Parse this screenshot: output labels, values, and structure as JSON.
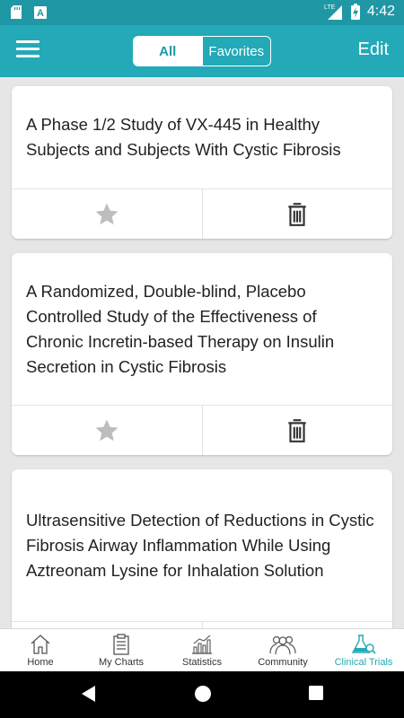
{
  "status_bar": {
    "time": "4:42",
    "network": "LTE",
    "icons": [
      "sd-card-icon",
      "font-a-icon",
      "signal-icon",
      "battery-charging-icon"
    ]
  },
  "header": {
    "segments": [
      {
        "label": "All",
        "active": true
      },
      {
        "label": "Favorites",
        "active": false
      }
    ],
    "edit_label": "Edit",
    "colors": {
      "accent": "#23a9b7",
      "status": "#1f97a5"
    }
  },
  "trials": [
    {
      "title": "A Phase 1/2 Study of VX-445 in Healthy Subjects and Subjects With Cystic Fibrosis",
      "favorited": false
    },
    {
      "title": "A Randomized, Double-blind, Placebo Controlled Study of the Effectiveness of Chronic Incretin-based Therapy on Insulin Secretion in Cystic Fibrosis",
      "favorited": false
    },
    {
      "title": "Ultrasensitive Detection of Reductions in Cystic Fibrosis Airway Inflammation While Using Aztreonam Lysine for Inhalation Solution",
      "favorited": false
    }
  ],
  "tabs": [
    {
      "label": "Home",
      "icon": "home-icon",
      "active": false
    },
    {
      "label": "My Charts",
      "icon": "clipboard-icon",
      "active": false
    },
    {
      "label": "Statistics",
      "icon": "bar-chart-icon",
      "active": false
    },
    {
      "label": "Community",
      "icon": "people-icon",
      "active": false
    },
    {
      "label": "Clinical Trials",
      "icon": "flask-icon",
      "active": true
    }
  ]
}
